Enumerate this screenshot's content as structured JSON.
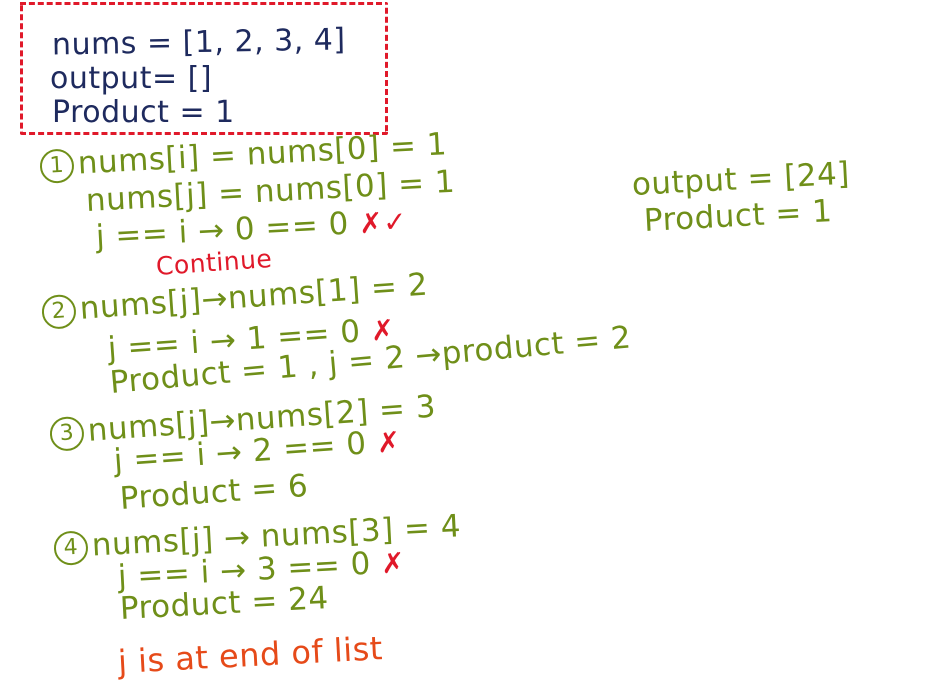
{
  "header": {
    "nums": "nums = [1, 2, 3, 4]",
    "output": "output= []",
    "product": "Product = 1"
  },
  "steps": [
    {
      "number": "1",
      "lines": [
        "nums[i] = nums[0] = 1",
        "nums[j] = nums[0] = 1",
        "j == i → 0 == 0"
      ],
      "marks": [
        "✗",
        "✓"
      ],
      "note": "Continue"
    },
    {
      "number": "2",
      "lines": [
        "nums[j]→nums[1] = 2",
        "j == i → 1 == 0",
        "Product = 1 , j = 2 →product = 2"
      ],
      "marks": [
        "✗"
      ]
    },
    {
      "number": "3",
      "lines": [
        "nums[j]→nums[2] = 3",
        "j == i → 2 == 0",
        "Product = 6"
      ],
      "marks": [
        "✗"
      ]
    },
    {
      "number": "4",
      "lines": [
        "nums[j] → nums[3] = 4",
        "j == i → 3 == 0",
        "Product = 24"
      ],
      "marks": [
        "✗"
      ]
    }
  ],
  "conclusion": "j is at end of list",
  "result": {
    "output": "output = [24]",
    "product": "Product = 1"
  },
  "colors": {
    "header_text": "#1e2a5e",
    "steps_text": "#6f8f19",
    "marks": "#e0192a",
    "conclusion": "#e64a19"
  }
}
